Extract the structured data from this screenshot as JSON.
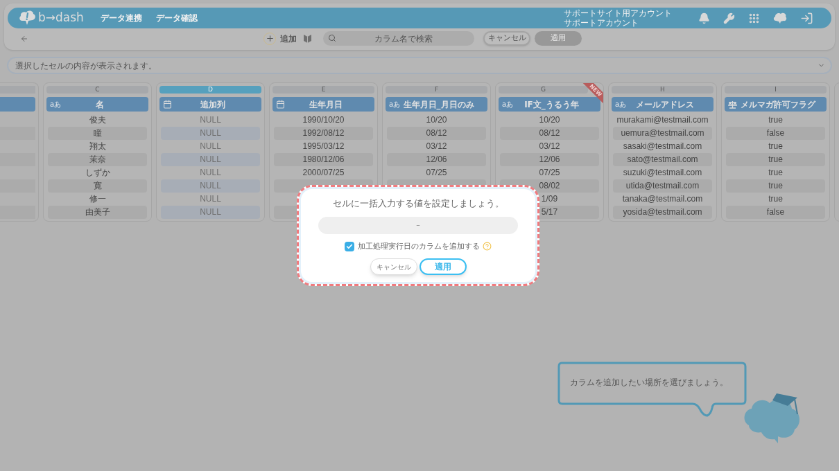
{
  "header": {
    "logo": "b→dash",
    "nav": [
      "データ連携",
      "データ確認"
    ],
    "account": [
      "サポートサイト用アカウント",
      "サポートアカウント"
    ]
  },
  "toolbar": {
    "add_label": "追加",
    "search": {
      "placeholder": "カラム名で検索"
    },
    "buttons": [
      {
        "label": "キャンセル",
        "kind": "outline"
      },
      {
        "label": "適用",
        "kind": "disabled"
      }
    ]
  },
  "cell_content_bar": {
    "placeholder": "選択したセルの内容が表示されます。"
  },
  "columns": [
    {
      "letter": "C",
      "name": "名",
      "kind": "text",
      "type_label": "aあ",
      "selected": false,
      "is_new": false,
      "cells": [
        "俊夫",
        "瞳",
        "翔太",
        "茉奈",
        "しずか",
        "寛",
        "修一",
        "由美子"
      ]
    },
    {
      "letter": "D",
      "name": "追加列",
      "kind": "date",
      "selected": true,
      "is_new": false,
      "cells": [
        "NULL",
        "NULL",
        "NULL",
        "NULL",
        "NULL",
        "NULL",
        "NULL",
        "NULL"
      ]
    },
    {
      "letter": "E",
      "name": "生年月日",
      "kind": "date",
      "selected": false,
      "is_new": false,
      "cells": [
        "1990/10/20",
        "1992/08/12",
        "1995/03/12",
        "1980/12/06",
        "2000/07/25",
        null,
        null,
        null
      ]
    },
    {
      "letter": "F",
      "name": "生年月日_月日のみ",
      "kind": "text",
      "type_label": "aあ",
      "selected": false,
      "is_new": false,
      "cells": [
        "10/20",
        "08/12",
        "03/12",
        "12/06",
        "07/25",
        null,
        null,
        null
      ]
    },
    {
      "letter": "G",
      "name": "IF文_うるう年",
      "kind": "text",
      "type_label": "aあ",
      "selected": false,
      "is_new": true,
      "new_label": "NEW",
      "cells": [
        "10/20",
        "08/12",
        "03/12",
        "12/06",
        "07/25",
        "08/02",
        "1/09",
        "5/17"
      ]
    },
    {
      "letter": "H",
      "name": "メールアドレス",
      "kind": "text",
      "type_label": "aあ",
      "selected": false,
      "is_new": false,
      "cells": [
        "murakami@testmail.com",
        "uemura@testmail.com",
        "sasaki@testmail.com",
        "sato@testmail.com",
        "suzuki@testmail.com",
        "utida@testmail.com",
        "tanaka@testmail.com",
        "yosida@testmail.com"
      ]
    },
    {
      "letter": "I",
      "name": "メルマガ許可フラグ",
      "kind": "flag",
      "selected": false,
      "is_new": false,
      "cells": [
        "true",
        "false",
        "true",
        "true",
        "true",
        "true",
        "true",
        "false"
      ]
    }
  ],
  "dialog": {
    "title": "セルに一括入力する値を設定しましょう。",
    "value": "–",
    "checkbox": {
      "label": "加工処理実行日のカラムを追加する",
      "checked": true
    },
    "buttons": [
      {
        "label": "キャンセル",
        "kind": "secondary"
      },
      {
        "label": "適用",
        "kind": "primary"
      }
    ]
  },
  "hint": {
    "text": "カラムを追加したい場所を選びましょう。"
  }
}
